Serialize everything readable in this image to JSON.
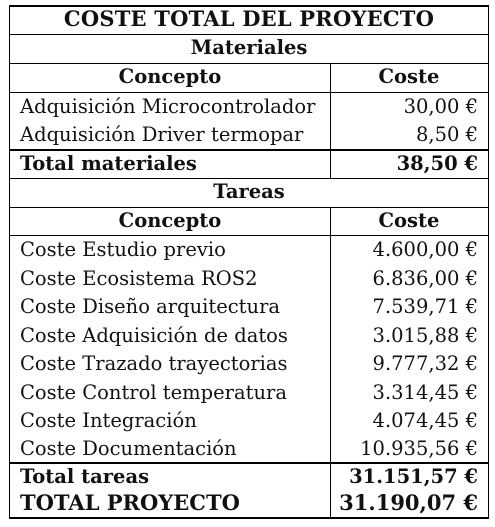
{
  "title": "COSTE TOTAL DEL PROYECTO",
  "materials": {
    "heading": "Materiales",
    "col_concept": "Concepto",
    "col_cost": "Coste",
    "items": [
      {
        "concept": "Adquisición Microcontrolador",
        "cost": "30,00 €"
      },
      {
        "concept": "Adquisición Driver termopar",
        "cost": "8,50 €"
      }
    ],
    "total_label": "Total materiales",
    "total_value": "38,50 €"
  },
  "tasks": {
    "heading": "Tareas",
    "col_concept": "Concepto",
    "col_cost": "Coste",
    "items": [
      {
        "concept": "Coste Estudio previo",
        "cost": "4.600,00 €"
      },
      {
        "concept": "Coste Ecosistema ROS2",
        "cost": "6.836,00 €"
      },
      {
        "concept": "Coste Diseño arquitectura",
        "cost": "7.539,71 €"
      },
      {
        "concept": "Coste Adquisición de datos",
        "cost": "3.015,88 €"
      },
      {
        "concept": "Coste Trazado trayectorias",
        "cost": "9.777,32 €"
      },
      {
        "concept": "Coste Control temperatura",
        "cost": "3.314,45 €"
      },
      {
        "concept": "Coste Integración",
        "cost": "4.074,45 €"
      },
      {
        "concept": "Coste Documentación",
        "cost": "10.935,56 €"
      }
    ],
    "total_label": "Total tareas",
    "total_value": "31.151,57 €"
  },
  "grand_total": {
    "label": "TOTAL PROYECTO",
    "value": "31.190,07 €"
  }
}
